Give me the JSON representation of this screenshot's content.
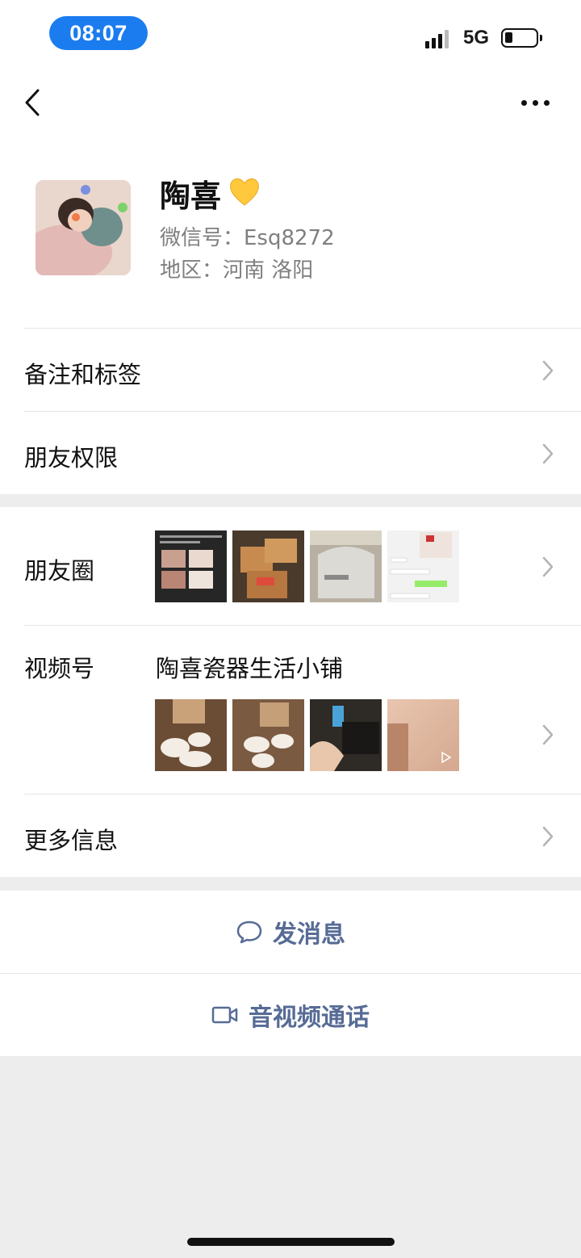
{
  "status_bar": {
    "time": "08:07",
    "network": "5G"
  },
  "profile": {
    "nickname": "陶喜",
    "wechat_id": "微信号：Esq8272",
    "region": "地区：河南 洛阳"
  },
  "menu": {
    "remarks_tags": "备注和标签",
    "friend_permissions": "朋友权限",
    "moments": "朋友圈",
    "channels": "视频号",
    "channel_name": "陶喜瓷器生活小铺",
    "more_info": "更多信息"
  },
  "actions": {
    "send_message": "发消息",
    "video_call": "音视频通话"
  },
  "colors": {
    "time_pill": "#1b7cf0",
    "link_blue": "#576b95",
    "background": "#ededed"
  },
  "icons": [
    "back-arrow-icon",
    "more-dots-icon",
    "yellow-heart-icon",
    "chevron-right-icon",
    "chat-bubble-icon",
    "video-camera-icon"
  ]
}
